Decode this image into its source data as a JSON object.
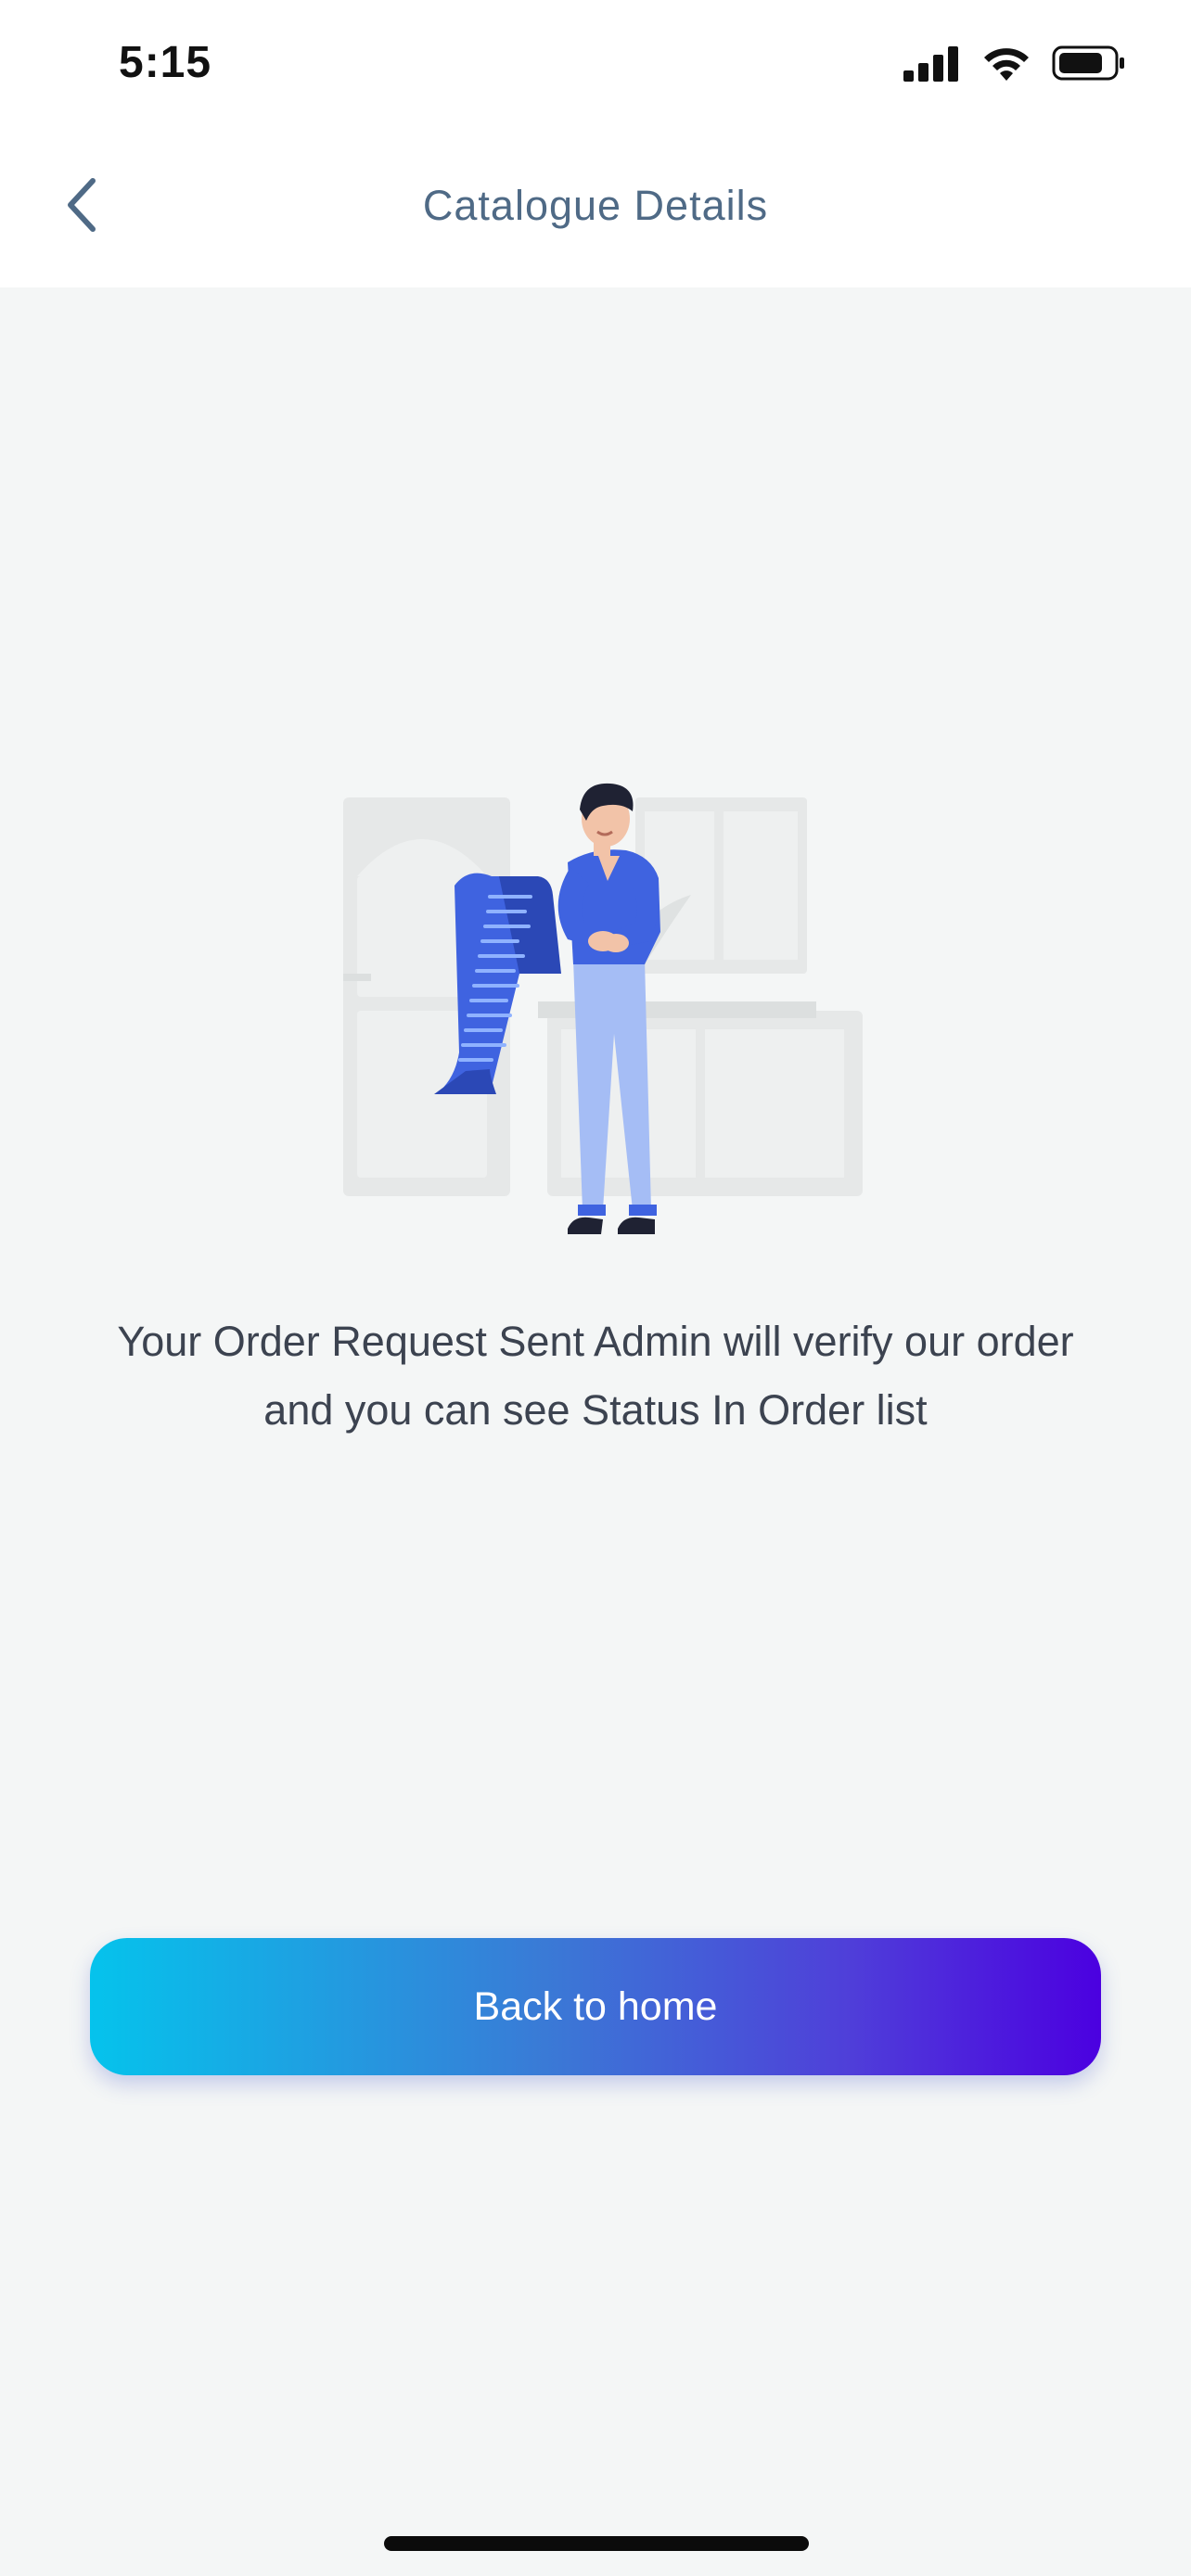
{
  "status_bar": {
    "time": "5:15"
  },
  "nav": {
    "title": "Catalogue Details",
    "back_icon": "chevron-left-icon"
  },
  "illustration": {
    "name": "person-holding-receipt-illustration"
  },
  "message": {
    "line1": "Your Order Request Sent Admin will verify our order",
    "line2": "and you can see Status In Order list"
  },
  "cta": {
    "label": "Back to home"
  },
  "colors": {
    "background": "#f4f6f6",
    "title": "#4f6a86",
    "message_text": "#3c4350",
    "gradient_start": "#05c3ec",
    "gradient_end": "#4b00e0"
  }
}
